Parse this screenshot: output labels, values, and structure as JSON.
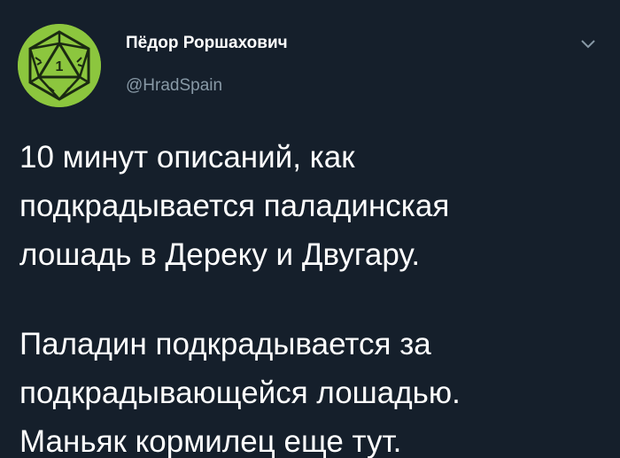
{
  "author": {
    "display_name": "Пёдор Роршахович",
    "handle": "@HradSpain",
    "avatar_icon": "d20-dice-icon",
    "avatar_digit": "1",
    "avatar_color": "#8cc63e"
  },
  "menu": {
    "icon": "chevron-down-icon"
  },
  "tweet": {
    "paragraph1": "10 минут описаний, как\nподкрадывается паладинская\nлошадь в Дереку и Двугару.",
    "paragraph2": "Паладин подкрадывается за\nподкрадывающейся лошадью.\nМаньяк кормилец еще тут."
  },
  "colors": {
    "background": "#151f2b",
    "text": "#ffffff",
    "secondary_text": "#8899a6"
  }
}
